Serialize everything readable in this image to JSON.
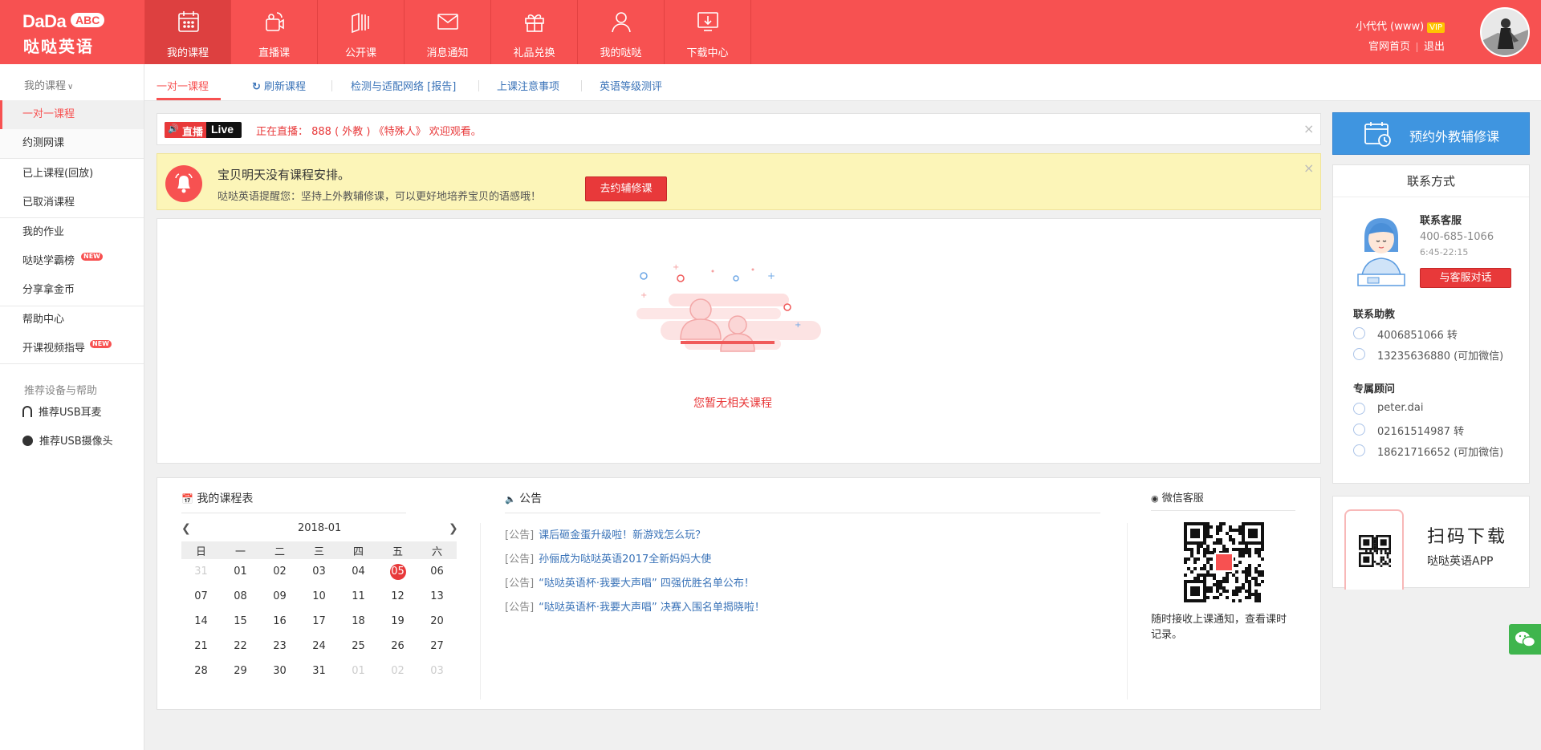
{
  "header": {
    "logo_text": "DaDa",
    "logo_abc": "ABC",
    "logo_cn": "哒哒英语",
    "nav": [
      {
        "label": "我的课程",
        "icon": "calendar-icon"
      },
      {
        "label": "直播课",
        "icon": "live-camera-icon"
      },
      {
        "label": "公开课",
        "icon": "open-class-icon"
      },
      {
        "label": "消息通知",
        "icon": "mail-icon"
      },
      {
        "label": "礼品兑换",
        "icon": "gift-icon"
      },
      {
        "label": "我的哒哒",
        "icon": "user-icon"
      },
      {
        "label": "下载中心",
        "icon": "download-icon"
      }
    ],
    "user_name": "小代代 (www)",
    "vip": "VIP",
    "link_home": "官网首页",
    "link_logout": "退出"
  },
  "sidebar": {
    "head": "我的课程",
    "items": [
      "一对一课程",
      "约测网课",
      "已上课程(回放)",
      "已取消课程",
      "我的作业",
      "哒哒学霸榜",
      "分享拿金币",
      "帮助中心",
      "开课视频指导"
    ],
    "new_badge": "NEW",
    "section2": "推荐设备与帮助",
    "devices": [
      "推荐USB耳麦",
      "推荐USB摄像头"
    ]
  },
  "subnav": {
    "tabs": [
      "一对一课程",
      "刷新课程",
      "检测与适配网络 [报告]",
      "上课注意事项",
      "英语等级测评"
    ]
  },
  "live_bar": {
    "badge_cn": "直播",
    "badge_en": "Live",
    "text": "正在直播： 888 ( 外教 ) 《特殊人》 欢迎观看。",
    "close": "×"
  },
  "reminder": {
    "title": "宝贝明天没有课程安排。",
    "subtitle": "哒哒英语提醒您：坚持上外教辅修课，可以更好地培养宝贝的语感哦！",
    "button": "去约辅修课",
    "close": "×"
  },
  "empty": {
    "text": "您暂无相关课程"
  },
  "schedule": {
    "title": "我的课程表",
    "month": "2018-01",
    "weekdays": [
      "日",
      "一",
      "二",
      "三",
      "四",
      "五",
      "六"
    ],
    "weeks": [
      [
        "31",
        "01",
        "02",
        "03",
        "04",
        "05",
        "06"
      ],
      [
        "07",
        "08",
        "09",
        "10",
        "11",
        "12",
        "13"
      ],
      [
        "14",
        "15",
        "16",
        "17",
        "18",
        "19",
        "20"
      ],
      [
        "21",
        "22",
        "23",
        "24",
        "25",
        "26",
        "27"
      ],
      [
        "28",
        "29",
        "30",
        "31",
        "01",
        "02",
        "03"
      ]
    ],
    "today": "05"
  },
  "announce": {
    "title": "公告",
    "tag": "[公告]",
    "items": [
      "课后砸金蛋升级啦！新游戏怎么玩？",
      "孙俪成为哒哒英语2017全新妈妈大使",
      "“哒哒英语杯·我要大声唱” 四强优胜名单公布！",
      "“哒哒英语杯·我要大声唱” 决赛入围名单揭晓啦！"
    ]
  },
  "wechat": {
    "title": "微信客服",
    "desc": "随时接收上课通知，查看课时记录。"
  },
  "right": {
    "book_button": "预约外教辅修课",
    "contact_title": "联系方式",
    "service_label": "联系客服",
    "service_phone": "400-685-1066",
    "service_hours": "6:45-22:15",
    "service_button": "与客服对话",
    "assistant_label": "联系助教",
    "assistant_rows": [
      "4006851066 转",
      "13235636880 (可加微信)"
    ],
    "advisor_label": "专属顾问",
    "advisor_rows": [
      "peter.dai",
      "02161514987 转",
      "18621716652 (可加微信)"
    ],
    "download_title": "扫码下载",
    "download_sub": "哒哒英语APP"
  }
}
